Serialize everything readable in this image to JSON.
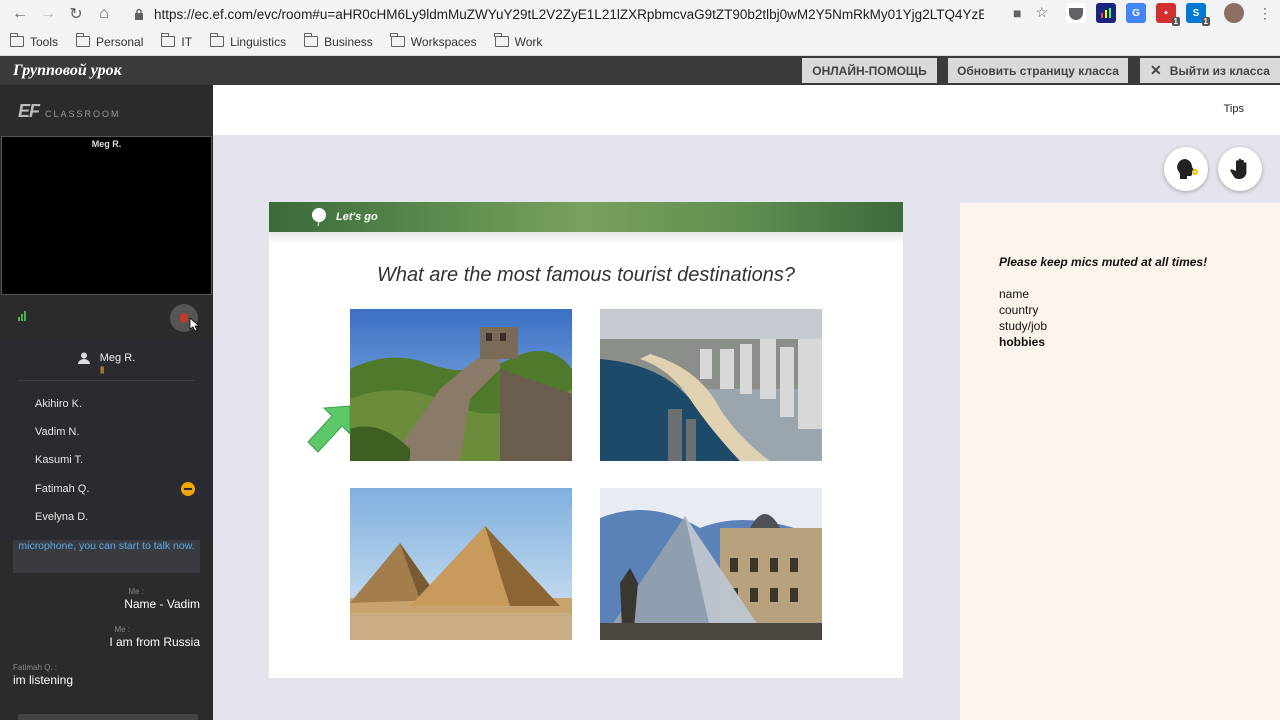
{
  "browser": {
    "url": "https://ec.ef.com/evc/room#u=aHR0cHM6Ly9ldmMuZWYuY29tL2V2ZyE1L21lZXRpbmcvaG9tZT90b2tlbj0wM2Y5NmRkMy01Yjg2LTQ4YzEtOD...",
    "bookmarks": [
      "Tools",
      "Personal",
      "IT",
      "Linguistics",
      "Business",
      "Workspaces",
      "Work"
    ]
  },
  "app": {
    "title": "Групповой урок",
    "help_label": "ОНЛАЙН-ПОМОЩЬ",
    "refresh_label": "Обновить страницу класса",
    "exit_label": "Выйти из класса",
    "tips_label": "Tips"
  },
  "sidebar": {
    "logo_ef": "EF",
    "logo_classroom": "CLASSROOM",
    "video_name": "Meg R.",
    "teacher": "Meg R.",
    "participants": [
      "Akihiro K.",
      "Vadim N.",
      "Kasumi T.",
      "Fatimah Q.",
      "Evelyna D."
    ]
  },
  "chat": {
    "notice": "microphone, you can start to talk now.",
    "messages": [
      {
        "who": "Me :",
        "text": "Name - Vadim"
      },
      {
        "who": "Me :",
        "text": "I am from Russia"
      },
      {
        "who": "Fatimah Q. :",
        "text": "im listening"
      }
    ]
  },
  "slide": {
    "banner": "Let's go",
    "question": "What are the most famous tourist destinations?",
    "photos": [
      "great-wall-photo",
      "rio-beach-photo",
      "pyramids-photo",
      "louvre-photo"
    ]
  },
  "notes": {
    "warning": "Please keep mics muted at all times!",
    "items": [
      "name",
      "country",
      "study/job",
      "hobbies"
    ]
  },
  "colors": {
    "header_bg": "#3a3a3a",
    "sidebar_bg": "#2b2b2b",
    "notes_bg": "#fbf3ec",
    "badge": "#f0a500",
    "chat_notice": "#5aa9e6"
  }
}
